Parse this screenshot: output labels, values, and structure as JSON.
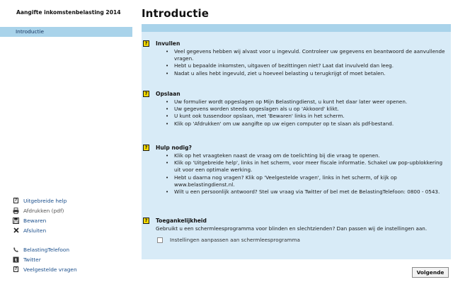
{
  "sidebar": {
    "app_title": "Aangifte inkomstenbelasting 2014",
    "nav": {
      "active_label": "Introductie"
    },
    "links_1": [
      {
        "label": "Uitgebreide help",
        "icon": "question-square-icon",
        "disabled": false
      },
      {
        "label": "Afdrukken (pdf)",
        "icon": "printer-icon",
        "disabled": true
      },
      {
        "label": "Bewaren",
        "icon": "save-icon",
        "disabled": false
      },
      {
        "label": "Afsluiten",
        "icon": "close-icon",
        "disabled": false
      }
    ],
    "links_2": [
      {
        "label": "BelastingTelefoon",
        "icon": "phone-icon"
      },
      {
        "label": "Twitter",
        "icon": "twitter-icon"
      },
      {
        "label": "Veelgestelde vragen",
        "icon": "question-square-icon"
      }
    ]
  },
  "main": {
    "title": "Introductie",
    "help_icon_text": "?",
    "sections": [
      {
        "title": "Invullen",
        "bullets": [
          "Veel gegevens hebben wij alvast voor u ingevuld. Controleer uw gegevens en beantwoord de aanvullende vragen.",
          "Hebt u bepaalde inkomsten, uitgaven of bezittingen niet? Laat dat invulveld dan leeg.",
          "Nadat u alles hebt ingevuld, ziet u hoeveel belasting u terugkrijgt of moet betalen."
        ]
      },
      {
        "title": "Opslaan",
        "bullets": [
          "Uw formulier wordt opgeslagen op Mijn Belastingdienst, u kunt het daar later weer openen.",
          "Uw gegevens worden steeds opgeslagen als u op 'Akkoord' klikt.",
          "U kunt ook tussendoor opslaan, met 'Bewaren' links in het scherm.",
          "Klik op 'Afdrukken' om uw aangifte op uw eigen computer op te slaan als pdf-bestand."
        ]
      },
      {
        "title": "Hulp nodig?",
        "bullets": [
          "Klik op het vraagteken naast de vraag om de toelichting bij die vraag te openen.",
          "Klik op 'Uitgebreide help', links in het scherm, voor meer fiscale informatie. Schakel uw pop-upblokkering uit voor een optimale werking.",
          "Hebt u daarna nog vragen? Klik op 'Veelgestelde vragen', links in het scherm, of kijk op www.belastingdienst.nl.",
          "Wilt u een persoonlijk antwoord? Stel uw vraag via Twitter of bel met de BelastingTelefoon: 0800 - 0543."
        ]
      },
      {
        "title": "Toegankelijkheid",
        "description": "Gebruikt u een schermleesprogramma voor blinden en slechtzienden? Dan passen wij de instellingen aan.",
        "checkbox_label": "Instellingen aanpassen aan schermleesprogramma",
        "checkbox_checked": false
      }
    ],
    "next_button_label": "Volgende"
  },
  "colors": {
    "panel_background": "#d8ebf7",
    "accent_bar": "#a9d3ea",
    "help_icon": "#f6d900",
    "link": "#1b4f8c"
  }
}
